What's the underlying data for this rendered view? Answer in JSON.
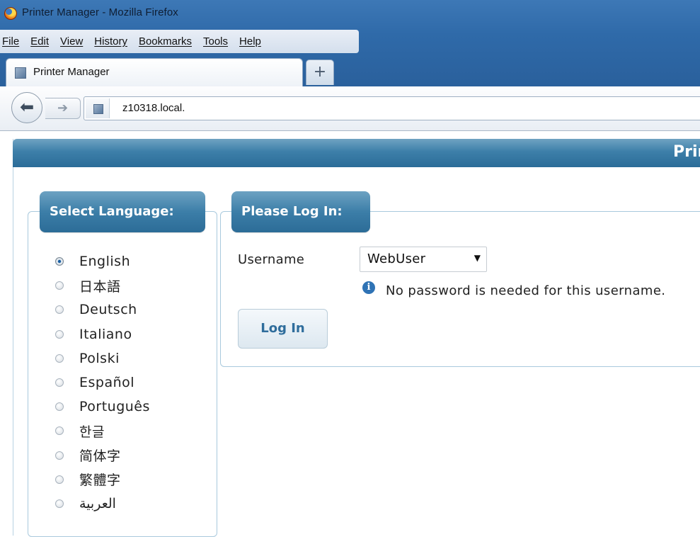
{
  "window": {
    "title": "Printer Manager - Mozilla Firefox"
  },
  "menu": [
    "File",
    "Edit",
    "View",
    "History",
    "Bookmarks",
    "Tools",
    "Help"
  ],
  "tab": {
    "label": "Printer Manager",
    "new_tab_label": "+"
  },
  "nav": {
    "url": "z10318.local."
  },
  "page": {
    "header_title": "Printer Manager"
  },
  "language": {
    "legend": "Select Language:",
    "options": [
      "English",
      "日本語",
      "Deutsch",
      "Italiano",
      "Polski",
      "Español",
      "Português",
      "한글",
      "简体字",
      "繁體字",
      "العربية"
    ],
    "selected": "English"
  },
  "login": {
    "legend": "Please Log In:",
    "username_label": "Username",
    "username_value": "WebUser",
    "info_text": "No password is needed for this username.",
    "button": "Log In"
  },
  "colors": {
    "accent": "#3d7fa9",
    "titlebar": "#2f6aa9"
  }
}
